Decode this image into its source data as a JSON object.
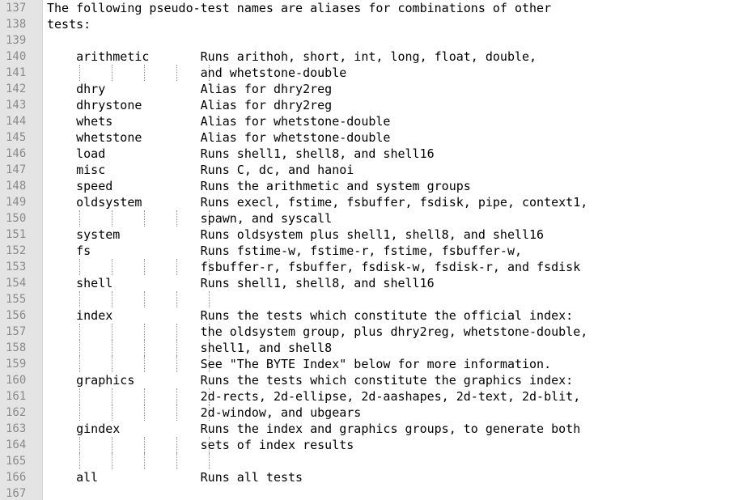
{
  "editor": {
    "colors": {
      "gutter_bg": "#e4e4e4",
      "line_number": "#8a8a8a",
      "text": "#000000",
      "indent_guide": "#9a9a9a"
    },
    "lines": [
      {
        "num": "137",
        "text": "The following pseudo-test names are aliases for combinations of other"
      },
      {
        "num": "138",
        "text": "tests:"
      },
      {
        "num": "139",
        "text": ""
      },
      {
        "num": "140",
        "text": "    arithmetic       Runs arithoh, short, int, long, float, double,"
      },
      {
        "num": "141",
        "text": "                     and whetstone-double"
      },
      {
        "num": "142",
        "text": "    dhry             Alias for dhry2reg"
      },
      {
        "num": "143",
        "text": "    dhrystone        Alias for dhry2reg"
      },
      {
        "num": "144",
        "text": "    whets            Alias for whetstone-double"
      },
      {
        "num": "145",
        "text": "    whetstone        Alias for whetstone-double"
      },
      {
        "num": "146",
        "text": "    load             Runs shell1, shell8, and shell16"
      },
      {
        "num": "147",
        "text": "    misc             Runs C, dc, and hanoi"
      },
      {
        "num": "148",
        "text": "    speed            Runs the arithmetic and system groups"
      },
      {
        "num": "149",
        "text": "    oldsystem        Runs execl, fstime, fsbuffer, fsdisk, pipe, context1,"
      },
      {
        "num": "150",
        "text": "                     spawn, and syscall"
      },
      {
        "num": "151",
        "text": "    system           Runs oldsystem plus shell1, shell8, and shell16"
      },
      {
        "num": "152",
        "text": "    fs               Runs fstime-w, fstime-r, fstime, fsbuffer-w,"
      },
      {
        "num": "153",
        "text": "                     fsbuffer-r, fsbuffer, fsdisk-w, fsdisk-r, and fsdisk"
      },
      {
        "num": "154",
        "text": "    shell            Runs shell1, shell8, and shell16"
      },
      {
        "num": "155",
        "text": ""
      },
      {
        "num": "156",
        "text": "    index            Runs the tests which constitute the official index:"
      },
      {
        "num": "157",
        "text": "                     the oldsystem group, plus dhry2reg, whetstone-double,"
      },
      {
        "num": "158",
        "text": "                     shell1, and shell8"
      },
      {
        "num": "159",
        "text": "                     See \"The BYTE Index\" below for more information."
      },
      {
        "num": "160",
        "text": "    graphics         Runs the tests which constitute the graphics index:"
      },
      {
        "num": "161",
        "text": "                     2d-rects, 2d-ellipse, 2d-aashapes, 2d-text, 2d-blit,"
      },
      {
        "num": "162",
        "text": "                     2d-window, and ubgears"
      },
      {
        "num": "163",
        "text": "    gindex           Runs the index and graphics groups, to generate both"
      },
      {
        "num": "164",
        "text": "                     sets of index results"
      },
      {
        "num": "165",
        "text": ""
      },
      {
        "num": "166",
        "text": "    all              Runs all tests"
      },
      {
        "num": "167",
        "text": ""
      }
    ]
  }
}
